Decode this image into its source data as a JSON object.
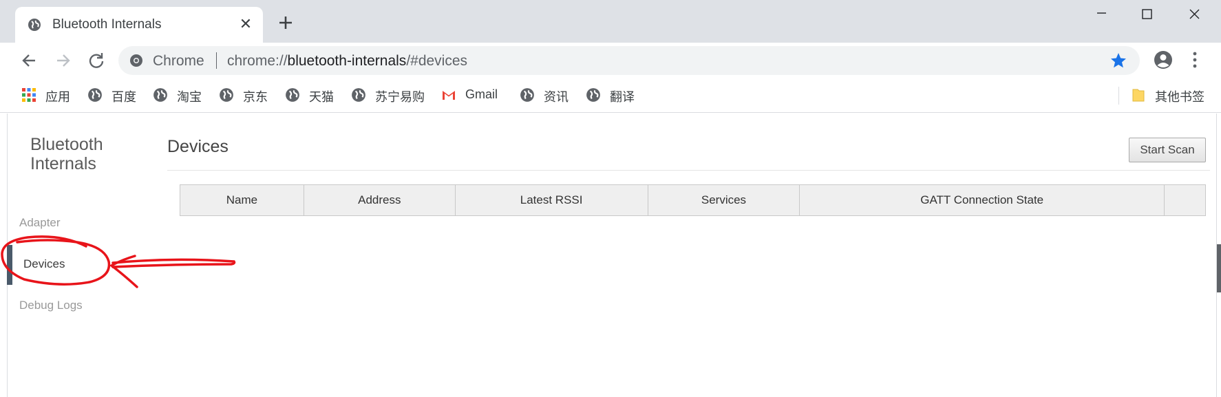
{
  "browser": {
    "tab": {
      "title": "Bluetooth Internals",
      "close_symbol": "✕"
    },
    "omnibox": {
      "chip": "Chrome",
      "url_scheme": "chrome://",
      "url_host": "bluetooth-internals",
      "url_path": "/#devices"
    },
    "bookmarks": [
      {
        "label": "应用",
        "icon": "apps-grid-icon"
      },
      {
        "label": "百度",
        "icon": "globe-icon"
      },
      {
        "label": "淘宝",
        "icon": "globe-icon"
      },
      {
        "label": "京东",
        "icon": "globe-icon"
      },
      {
        "label": "天猫",
        "icon": "globe-icon"
      },
      {
        "label": "苏宁易购",
        "icon": "globe-icon"
      },
      {
        "label": "Gmail",
        "icon": "gmail-icon"
      },
      {
        "label": "资讯",
        "icon": "globe-icon"
      },
      {
        "label": "翻译",
        "icon": "globe-icon"
      }
    ],
    "other_bookmarks": "其他书签",
    "colors": {
      "tabstrip": "#dee1e6",
      "accent_star": "#1a73e8",
      "annotation": "#e8141a"
    }
  },
  "page": {
    "sidebar": {
      "title": "Bluetooth Internals",
      "items": [
        {
          "label": "Adapter",
          "active": false
        },
        {
          "label": "Devices",
          "active": true
        },
        {
          "label": "Debug Logs",
          "active": false
        }
      ]
    },
    "heading": "Devices",
    "start_scan_label": "Start Scan",
    "table_headers": [
      "Name",
      "Address",
      "Latest RSSI",
      "Services",
      "GATT Connection State",
      ""
    ],
    "table_rows": []
  }
}
